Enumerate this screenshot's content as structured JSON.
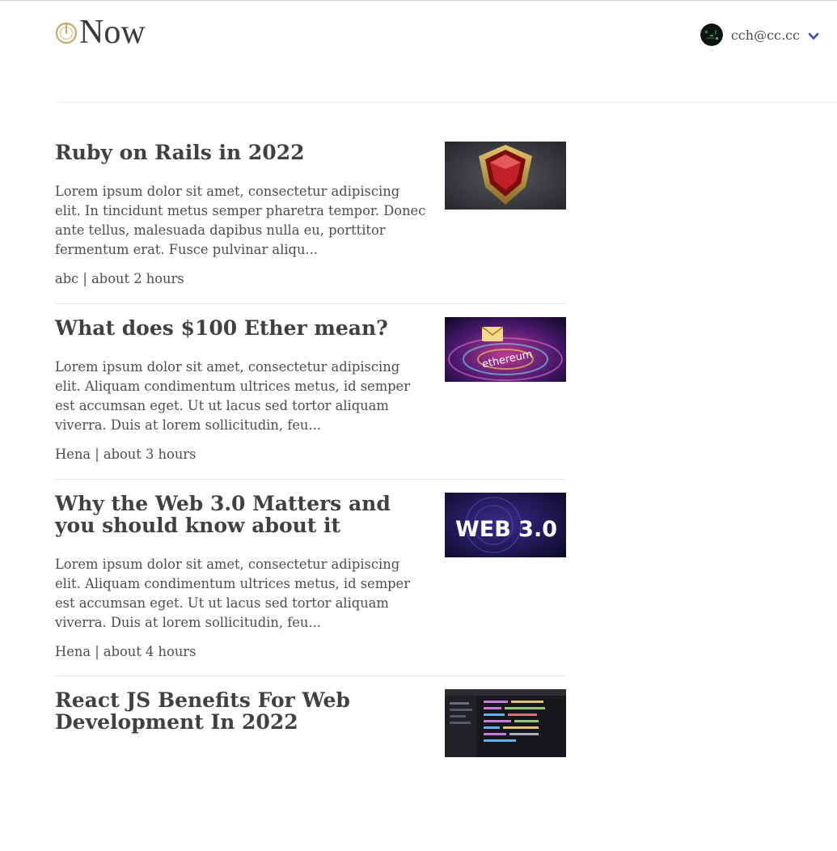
{
  "brand": {
    "logo_text": "Now",
    "logo_icon": "power-icon"
  },
  "user": {
    "email": "cch@cc.cc",
    "avatar_icon": "avatar-icon",
    "dropdown_icon": "chevron-down-icon"
  },
  "colors": {
    "accent": "#3b4fb8",
    "logo_gold": "#c9a86a",
    "text": "#404040"
  },
  "posts": [
    {
      "title": "Ruby on Rails in 2022",
      "excerpt": "Lorem ipsum dolor sit amet, consectetur adipiscing elit. In tincidunt metus semper pharetra tempor. Donec ante tellus, malesuada dapibus nulla eu, porttitor fermentum erat. Fusce pulvinar aliqu...",
      "meta": "abc | about 2 hours"
    },
    {
      "title": "What does $100 Ether mean?",
      "excerpt": "Lorem ipsum dolor sit amet, consectetur adipiscing elit. Aliquam condimentum ultrices metus, id semper est accumsan eget. Ut ut lacus sed tortor aliquam viverra. Duis at lorem sollicitudin, feu...",
      "meta": "Hena | about 3 hours",
      "thumb_text": "ethereum"
    },
    {
      "title": "Why the Web 3.0 Matters and you should know about it",
      "excerpt": "Lorem ipsum dolor sit amet, consectetur adipiscing elit. Aliquam condimentum ultrices metus, id semper est accumsan eget. Ut ut lacus sed tortor aliquam viverra. Duis at lorem sollicitudin, feu...",
      "meta": "Hena | about 4 hours",
      "thumb_text": "WEB 3.0"
    },
    {
      "title": "React JS Benefits For Web Development In 2022",
      "excerpt": "",
      "meta": ""
    }
  ]
}
